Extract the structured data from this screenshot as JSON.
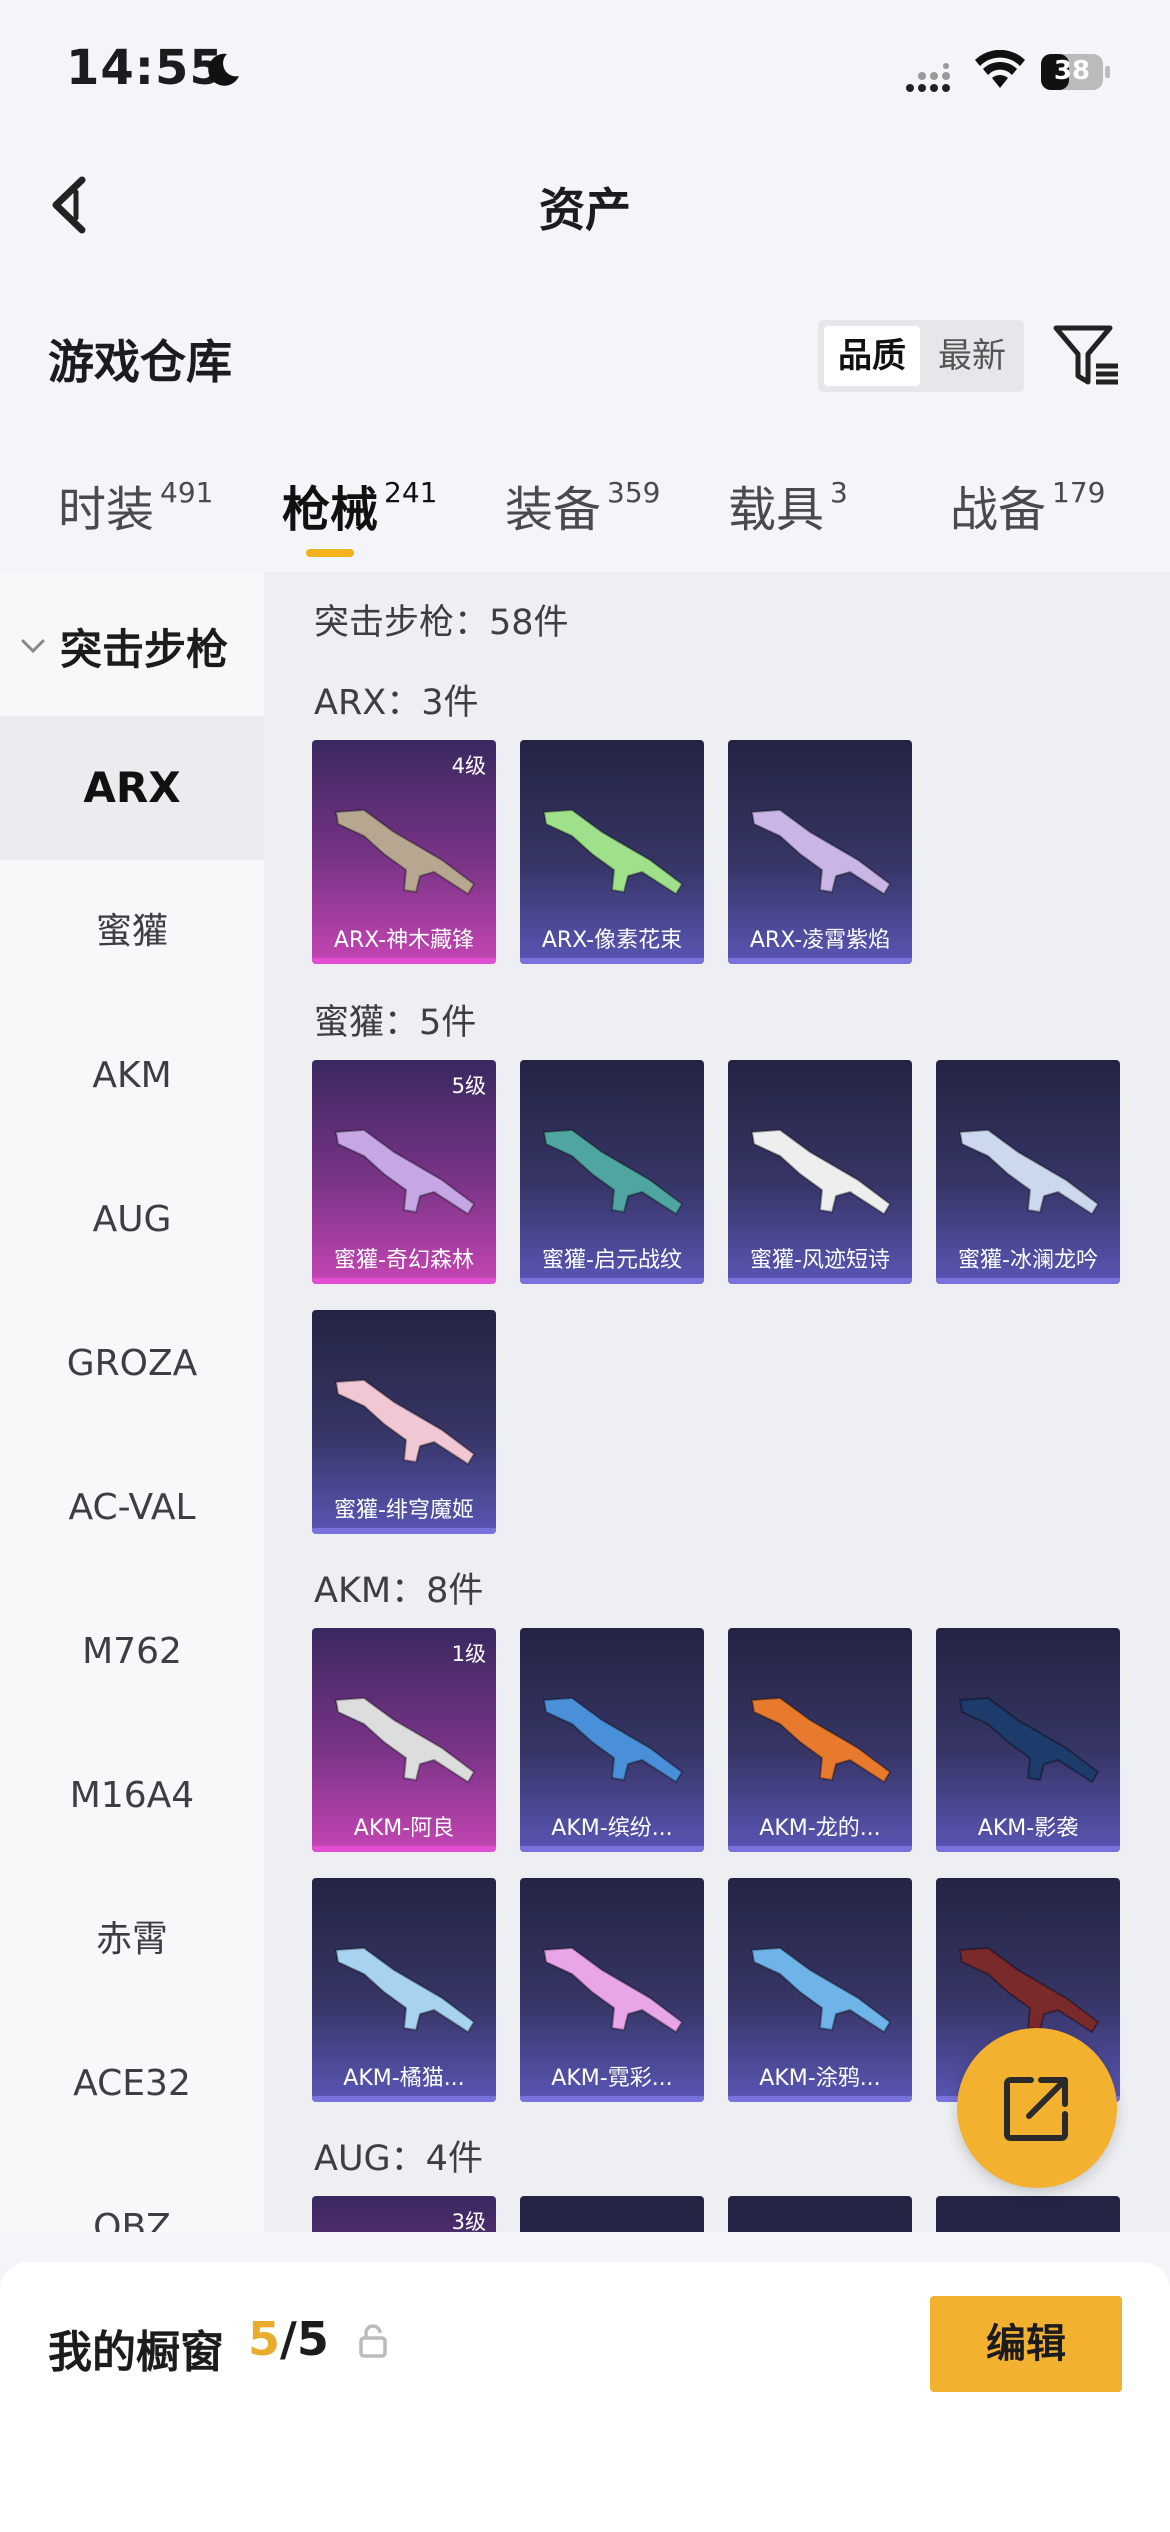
{
  "status": {
    "time": "14:55",
    "battery": "38"
  },
  "nav": {
    "title": "资产"
  },
  "header": {
    "title": "游戏仓库",
    "sort_quality": "品质",
    "sort_latest": "最新"
  },
  "tabs": [
    {
      "label": "时装",
      "count": "491"
    },
    {
      "label": "枪械",
      "count": "241"
    },
    {
      "label": "装备",
      "count": "359"
    },
    {
      "label": "载具",
      "count": "3"
    },
    {
      "label": "战备",
      "count": "179"
    }
  ],
  "sidebar": {
    "category": "突击步枪",
    "items": [
      "ARX",
      "蜜獾",
      "AKM",
      "AUG",
      "GROZA",
      "AC-VAL",
      "M762",
      "M16A4",
      "赤霄",
      "ACE32",
      "QBZ"
    ]
  },
  "main": {
    "total": "突击步枪：58件",
    "groups": [
      {
        "heading": "ARX：3件",
        "items": [
          {
            "name": "ARX-神木藏锋",
            "level": "4级",
            "tier": "pink"
          },
          {
            "name": "ARX-像素花束",
            "tier": "blue"
          },
          {
            "name": "ARX-凌霄紫焰",
            "tier": "blue"
          }
        ]
      },
      {
        "heading": "蜜獾：5件",
        "items": [
          {
            "name": "蜜獾-奇幻森林",
            "level": "5级",
            "tier": "pink"
          },
          {
            "name": "蜜獾-启元战纹",
            "tier": "blue"
          },
          {
            "name": "蜜獾-风迹短诗",
            "tier": "blue"
          },
          {
            "name": "蜜獾-冰澜龙吟",
            "tier": "blue"
          },
          {
            "name": "蜜獾-绯穹魔姬",
            "tier": "blue"
          }
        ]
      },
      {
        "heading": "AKM：8件",
        "items": [
          {
            "name": "AKM-阿良",
            "level": "1级",
            "tier": "pink"
          },
          {
            "name": "AKM-缤纷...",
            "tier": "blue"
          },
          {
            "name": "AKM-龙的...",
            "tier": "blue"
          },
          {
            "name": "AKM-影袭",
            "tier": "blue"
          },
          {
            "name": "AKM-橘猫...",
            "tier": "blue"
          },
          {
            "name": "AKM-霓彩...",
            "tier": "blue"
          },
          {
            "name": "AKM-涂鸦...",
            "tier": "blue"
          },
          {
            "name": "",
            "tier": "blue"
          }
        ]
      },
      {
        "heading": "AUG：4件",
        "items": [
          {
            "name": "",
            "level": "3级",
            "tier": "pink"
          },
          {
            "name": "",
            "tier": "dark"
          },
          {
            "name": "",
            "tier": "dark"
          },
          {
            "name": "",
            "tier": "dark"
          }
        ]
      }
    ]
  },
  "bottom": {
    "label": "我的橱窗",
    "count_current": "5",
    "count_sep": "/",
    "count_total": "5",
    "edit_label": "编辑"
  },
  "colors": {
    "accent": "#f3b130",
    "rare": "#e04fd2",
    "epic": "#7a72dc"
  },
  "icons": [
    "moon-icon",
    "signal-icon",
    "wifi-icon",
    "battery-icon",
    "back-icon",
    "filter-icon",
    "chevron-down-icon",
    "share-icon",
    "lock-icon"
  ]
}
